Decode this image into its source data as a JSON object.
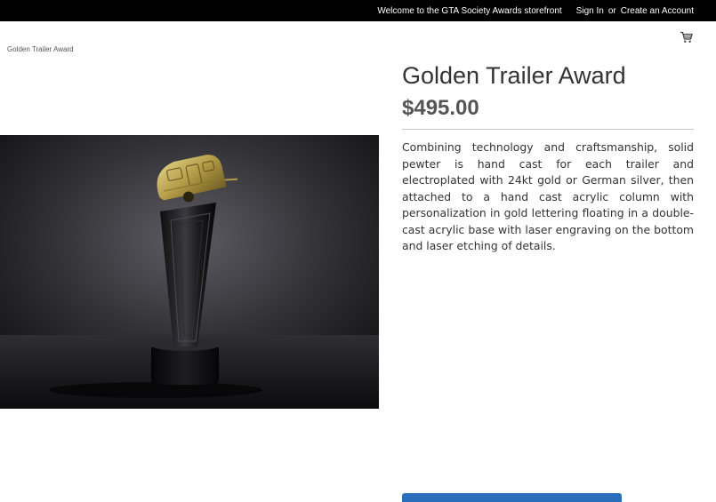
{
  "top_bar": {
    "welcome": "Welcome to the GTA Society Awards storefront",
    "sign_in": "Sign In",
    "or": "or",
    "create_account": "Create an Account"
  },
  "header": {
    "cart_icon": "shopping-cart-icon"
  },
  "breadcrumb": {
    "current": "Golden Trailer Award"
  },
  "product": {
    "title": "Golden Trailer Award",
    "price": "$495.00",
    "description": "Combining technology and craftsmanship, solid pewter is hand cast for each trailer and electroplated with 24kt gold or German silver, then attached to a hand cast acrylic column with personalization in gold lettering floating in a double-cast acrylic base with laser engraving on the bottom and laser etching of details.",
    "image_alt": "Golden Trailer Award trophy"
  },
  "colors": {
    "top_bar_bg": "#000000",
    "button_blue": "#2a6ebb",
    "trophy_gold": "#c8b25a"
  }
}
